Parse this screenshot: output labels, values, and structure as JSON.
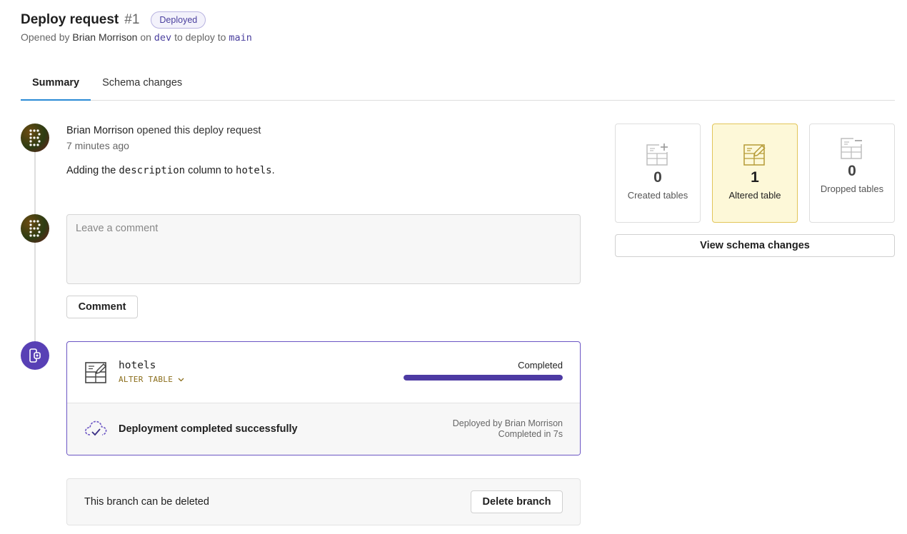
{
  "header": {
    "title": "Deploy request",
    "number": "#1",
    "status_badge": "Deployed",
    "opened_by_prefix": "Opened by",
    "author": "Brian Morrison",
    "on_text": "on",
    "source_branch": "dev",
    "to_text": "to deploy to",
    "target_branch": "main"
  },
  "tabs": [
    {
      "label": "Summary",
      "active": true
    },
    {
      "label": "Schema changes",
      "active": false
    }
  ],
  "timeline": {
    "event_author": "Brian Morrison",
    "event_action": "opened this deploy request",
    "event_time": "7 minutes ago",
    "desc_prefix": "Adding the",
    "desc_column": "description",
    "desc_middle": "column to",
    "desc_table": "hotels",
    "desc_suffix": "."
  },
  "comment": {
    "placeholder": "Leave a comment",
    "button_label": "Comment"
  },
  "deployment": {
    "table_name": "hotels",
    "operation": "ALTER TABLE",
    "status": "Completed",
    "progress": 1.0,
    "success_message": "Deployment completed successfully",
    "deployed_by": "Deployed by Brian Morrison",
    "duration": "Completed in 7s"
  },
  "branch": {
    "message": "This branch can be deleted",
    "delete_label": "Delete branch"
  },
  "stats": [
    {
      "count": "0",
      "label": "Created tables",
      "icon": "table-plus-icon",
      "highlight": false
    },
    {
      "count": "1",
      "label": "Altered table",
      "icon": "table-edit-icon",
      "highlight": true
    },
    {
      "count": "0",
      "label": "Dropped tables",
      "icon": "table-minus-icon",
      "highlight": false
    }
  ],
  "view_schema_label": "View schema changes",
  "colors": {
    "accent": "#4d3aa3",
    "badge_border": "#b8b3e0",
    "tab_underline": "#2a8bd6",
    "altered_bg": "#fdf8d8",
    "altered_border": "#e2c55a"
  }
}
